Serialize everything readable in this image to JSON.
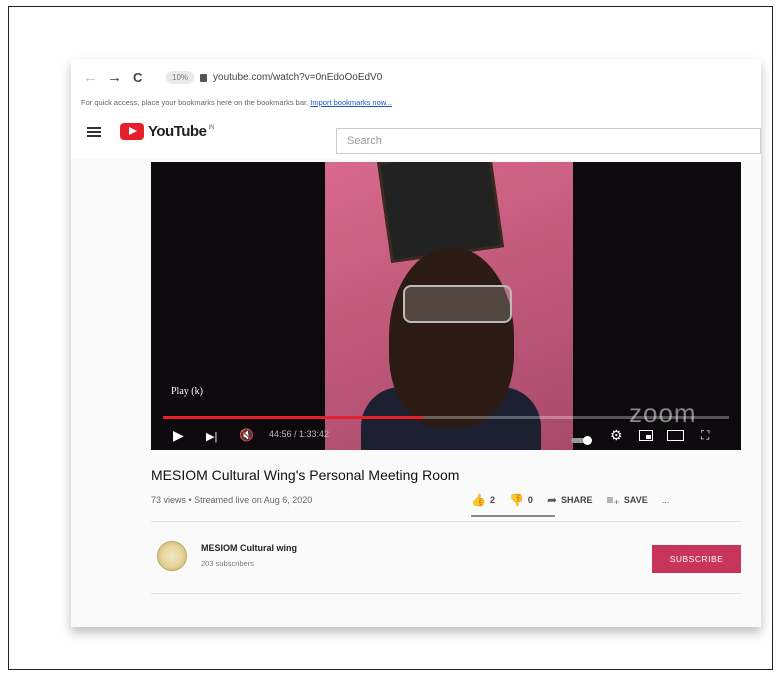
{
  "browser": {
    "back_label": "←",
    "forward_label": "→",
    "reload_label": "C",
    "zoom_pill": "10%",
    "url": "youtube.com/watch?v=0nEdoOoEdV0",
    "bookmarks_hint": "For quick access, place your bookmarks here on the bookmarks bar.",
    "import_link": "Import bookmarks now..."
  },
  "youtube": {
    "logo_text": "YouTube",
    "logo_sup": "IN",
    "search_placeholder": "Search"
  },
  "player": {
    "tooltip": "Play (k)",
    "time": "44:56 / 1:33:42",
    "watermark": "zoom",
    "progress": 0.46,
    "play_icon": "▶",
    "next_icon": "▶|",
    "mute_icon": "🔇",
    "settings_icon": "⚙",
    "fullscreen_icon": "⛶"
  },
  "video": {
    "title": "MESIOM Cultural Wing's Personal Meeting Room",
    "meta": "73 views • Streamed live on Aug 6, 2020",
    "likes": "2",
    "dislikes": "0",
    "share_label": "SHARE",
    "save_label": "SAVE",
    "more_label": "..."
  },
  "channel": {
    "name": "MESIOM Cultural wing",
    "subscribers": "203 subscribers",
    "subscribe_label": "SUBSCRIBE"
  },
  "colors": {
    "youtube_red": "#e5202b",
    "subscribe_red": "#c8345a",
    "link_blue": "#1a56c9"
  }
}
